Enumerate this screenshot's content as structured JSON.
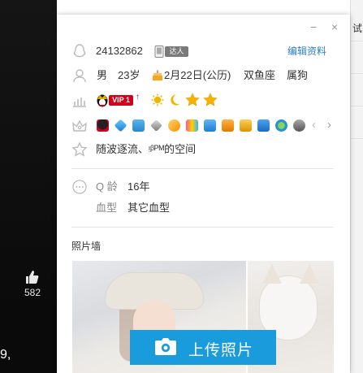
{
  "background": {
    "like_count": "582",
    "left_text": "9,",
    "right_text": "试"
  },
  "window": {
    "minimize": "−",
    "close": "×"
  },
  "profile": {
    "qq_number": "24132862",
    "master_badge": "达人",
    "edit_link": "编辑资料",
    "gender": "男",
    "age": "23岁",
    "birthday": "2月22日(公历)",
    "constellation": "双鱼座",
    "zodiac": "属狗",
    "vip_badge": "VIP 1",
    "signature": "随波逐流、ᵎᵝᴾᴹ的空间",
    "qage_label": "Q 龄",
    "qage_value": "16年",
    "blood_label": "血型",
    "blood_value": "其它血型",
    "photo_wall_title": "照片墙",
    "upload_button": "上传照片"
  },
  "colors": {
    "accent": "#1a9bdc",
    "link": "#2a7ec8",
    "vip_red": "#d0021b",
    "star_gold": "#f5b400"
  },
  "icons": {
    "level": [
      "sun-icon",
      "moon-icon",
      "star-icon",
      "star-icon"
    ],
    "services": [
      "penguin-icon",
      "diamond-icon",
      "gift-icon",
      "gem-icon",
      "star-badge-icon",
      "qzone-icon",
      "music-icon",
      "game-icon",
      "pet-icon",
      "photo-icon",
      "browser-icon",
      "heart-icon"
    ]
  }
}
